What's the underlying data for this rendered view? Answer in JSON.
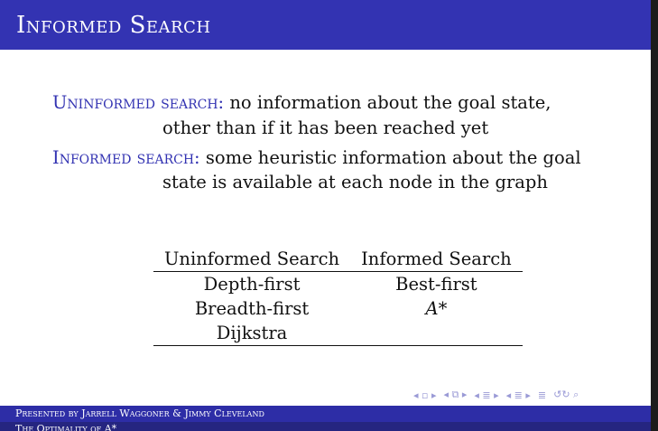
{
  "slide": {
    "title": "Informed Search",
    "uninformed_term": "Uninformed search:",
    "uninformed_line1": "no information about the goal state,",
    "uninformed_line2": "other than if it has been reached yet",
    "informed_term": "Informed search:",
    "informed_line1": "some heuristic information about the goal",
    "informed_line2": "state is available at each node in the graph"
  },
  "table": {
    "headers": [
      "Uninformed Search",
      "Informed Search"
    ],
    "rows": [
      [
        "Depth-first",
        "Best-first"
      ],
      [
        "Breadth-first",
        "A*"
      ],
      [
        "Dijkstra",
        ""
      ]
    ]
  },
  "nav": {
    "icons": [
      "frame-prev-icon",
      "frame-next-icon",
      "subsection-prev-icon",
      "subsection-next-icon",
      "section-prev-icon",
      "section-next-icon",
      "slide-prev-icon",
      "slide-next-icon",
      "align-icon",
      "search-icon"
    ],
    "glyphs": [
      "◂ ▫ ▸",
      "◂ ⧉ ▸",
      "◂ ≣ ▸",
      "◂ ≣ ▸",
      "≣",
      "↺↻ ⌕"
    ]
  },
  "footer": {
    "line1": "Presented by Jarrell Waggoner & Jimmy Cleveland",
    "line2": "The Optimality of A*"
  },
  "colors": {
    "title_bar": "#3333b2",
    "accent_term": "#3333b2",
    "footer_top": "#2d2da6",
    "footer_bottom": "#252580"
  }
}
